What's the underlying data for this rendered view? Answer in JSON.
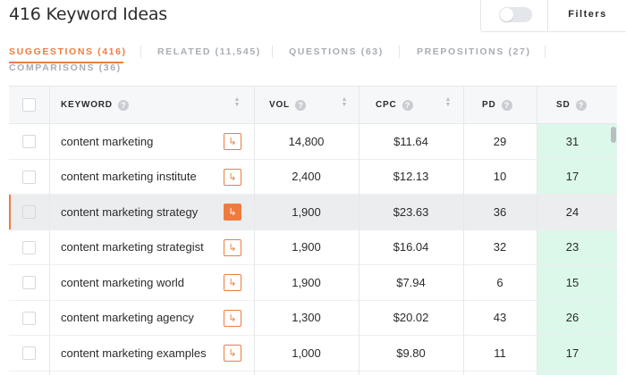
{
  "header": {
    "title": "416 Keyword Ideas",
    "filters_label": "Filters"
  },
  "tabs": [
    {
      "label": "SUGGESTIONS (416)",
      "active": true
    },
    {
      "label": "RELATED (11,545)",
      "active": false
    },
    {
      "label": "QUESTIONS (63)",
      "active": false
    },
    {
      "label": "PREPOSITIONS (27)",
      "active": false
    },
    {
      "label": "COMPARISONS (36)",
      "active": false
    }
  ],
  "table": {
    "columns": {
      "keyword": "KEYWORD",
      "vol": "VOL",
      "cpc": "CPC",
      "pd": "PD",
      "sd": "SD"
    },
    "help_glyph": "?",
    "rows": [
      {
        "keyword": "content marketing",
        "vol": "14,800",
        "cpc": "$11.64",
        "pd": "29",
        "sd": "31"
      },
      {
        "keyword": "content marketing institute",
        "vol": "2,400",
        "cpc": "$12.13",
        "pd": "10",
        "sd": "17"
      },
      {
        "keyword": "content marketing strategy",
        "vol": "1,900",
        "cpc": "$23.63",
        "pd": "36",
        "sd": "24",
        "highlighted": true
      },
      {
        "keyword": "content marketing strategist",
        "vol": "1,900",
        "cpc": "$16.04",
        "pd": "32",
        "sd": "23"
      },
      {
        "keyword": "content marketing world",
        "vol": "1,900",
        "cpc": "$7.94",
        "pd": "6",
        "sd": "15"
      },
      {
        "keyword": "content marketing agency",
        "vol": "1,300",
        "cpc": "$20.02",
        "pd": "43",
        "sd": "26"
      },
      {
        "keyword": "content marketing examples",
        "vol": "1,000",
        "cpc": "$9.80",
        "pd": "11",
        "sd": "17"
      }
    ]
  },
  "colors": {
    "accent": "#f07b3f",
    "sd_bg": "#dcf8ea",
    "sd_bg_highlight": "#8ee8bd",
    "row_highlight": "#ecedef"
  },
  "icons": {
    "arrow": "open-arrow-icon",
    "help": "question-mark-icon",
    "sort": "sort-arrows-icon"
  }
}
